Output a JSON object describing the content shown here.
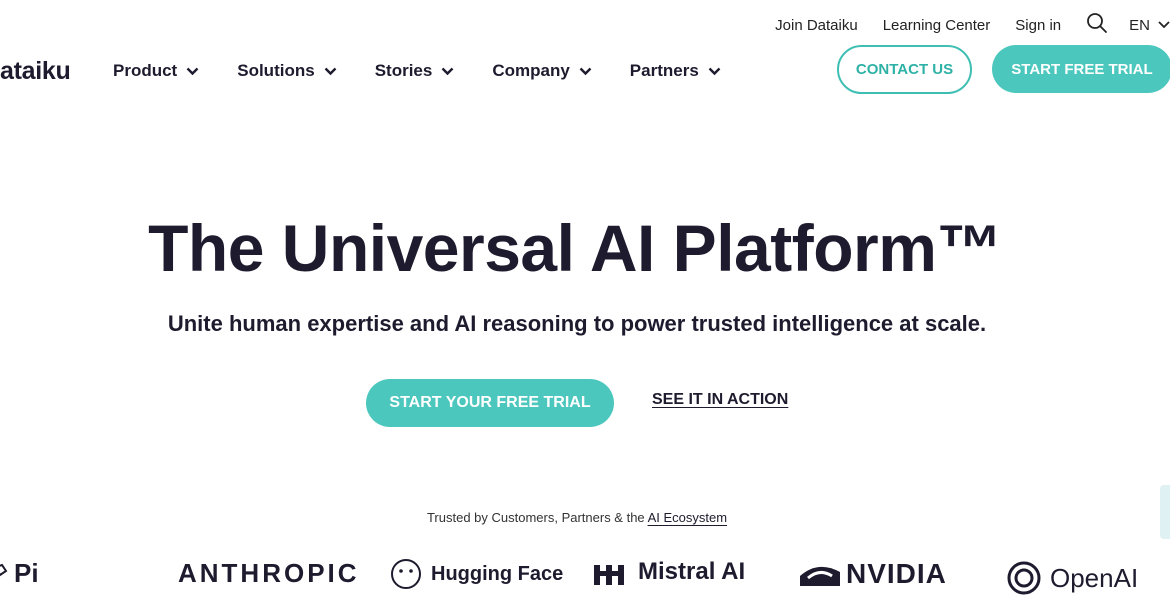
{
  "topbar": {
    "links": [
      "Join Dataiku",
      "Learning Center",
      "Sign in"
    ],
    "lang": "EN"
  },
  "brand": {
    "logo_text": "ataiku"
  },
  "nav": {
    "items": [
      "Product",
      "Solutions",
      "Stories",
      "Company",
      "Partners"
    ]
  },
  "header_buttons": {
    "contact": "CONTACT US",
    "trial": "START FREE TRIAL"
  },
  "hero": {
    "title": "The Universal AI Platform™",
    "subtitle": "Unite human expertise and AI reasoning to power trusted intelligence at scale.",
    "cta_primary": "START YOUR FREE TRIAL",
    "cta_secondary": "SEE IT IN ACTION"
  },
  "trusted": {
    "prefix": "Trusted by Customers, Partners & the ",
    "link": "AI Ecosystem"
  },
  "partner_logos": [
    "Pi",
    "ANTHROPIC",
    "Hugging Face",
    "Mistral AI",
    "NVIDIA",
    "OpenAI"
  ],
  "colors": {
    "accent": "#4cc7bd",
    "text": "#1e1b2e"
  }
}
